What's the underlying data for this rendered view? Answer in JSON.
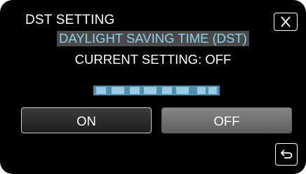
{
  "header": {
    "title": "DST SETTING"
  },
  "subtitle": "DAYLIGHT SAVING TIME (DST)",
  "current_setting": "CURRENT SETTING: OFF",
  "options": {
    "on_label": "ON",
    "off_label": "OFF"
  },
  "icons": {
    "close": "close-icon",
    "back": "return-arrow-icon"
  },
  "colors": {
    "background": "#000000",
    "subtitle_text": "#8fd0ea",
    "subtitle_highlight": "#4a4a4a",
    "selected_option": "#757575",
    "progress_bar": "#4e8fb0"
  }
}
